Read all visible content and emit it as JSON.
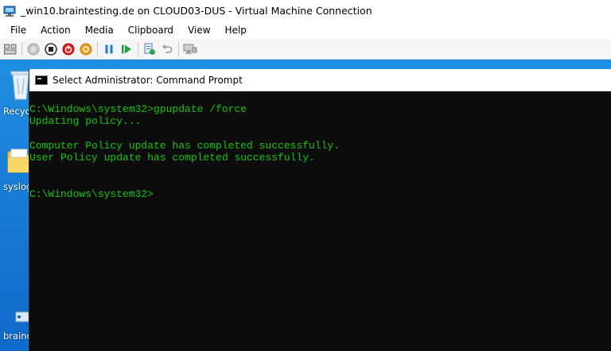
{
  "window": {
    "title": "_win10.braintesting.de on CLOUD03-DUS - Virtual Machine Connection"
  },
  "menu": {
    "items": [
      {
        "label": "File"
      },
      {
        "label": "Action"
      },
      {
        "label": "Media"
      },
      {
        "label": "Clipboard"
      },
      {
        "label": "View"
      },
      {
        "label": "Help"
      }
    ]
  },
  "toolbar": {
    "buttons": [
      {
        "icon": "ctrl-alt-del-icon"
      },
      {
        "icon": "start-icon"
      },
      {
        "icon": "turn-off-icon"
      },
      {
        "icon": "shutdown-icon"
      },
      {
        "icon": "save-state-icon"
      },
      {
        "icon": "pause-icon"
      },
      {
        "icon": "resume-icon"
      },
      {
        "icon": "checkpoint-icon"
      },
      {
        "icon": "revert-icon"
      },
      {
        "icon": "enhanced-session-icon"
      }
    ]
  },
  "desktop": {
    "icons": [
      {
        "label": "Recyc",
        "icon": "recycle-bin-icon"
      },
      {
        "label": "syslog",
        "icon": "folder-icon"
      },
      {
        "label": "brainc",
        "icon": "app-shortcut-icon"
      }
    ]
  },
  "cmd": {
    "title": "Select Administrator: Command Prompt",
    "lines": [
      "C:\\Windows\\system32>gpupdate /force",
      "Updating policy...",
      "",
      "Computer Policy update has completed successfully.",
      "User Policy update has completed successfully.",
      "",
      "",
      "C:\\Windows\\system32>"
    ]
  },
  "colors": {
    "console_text": "#16c60c",
    "console_bg": "#0c0c0c",
    "desktop_bg": "#1a7fd8"
  }
}
